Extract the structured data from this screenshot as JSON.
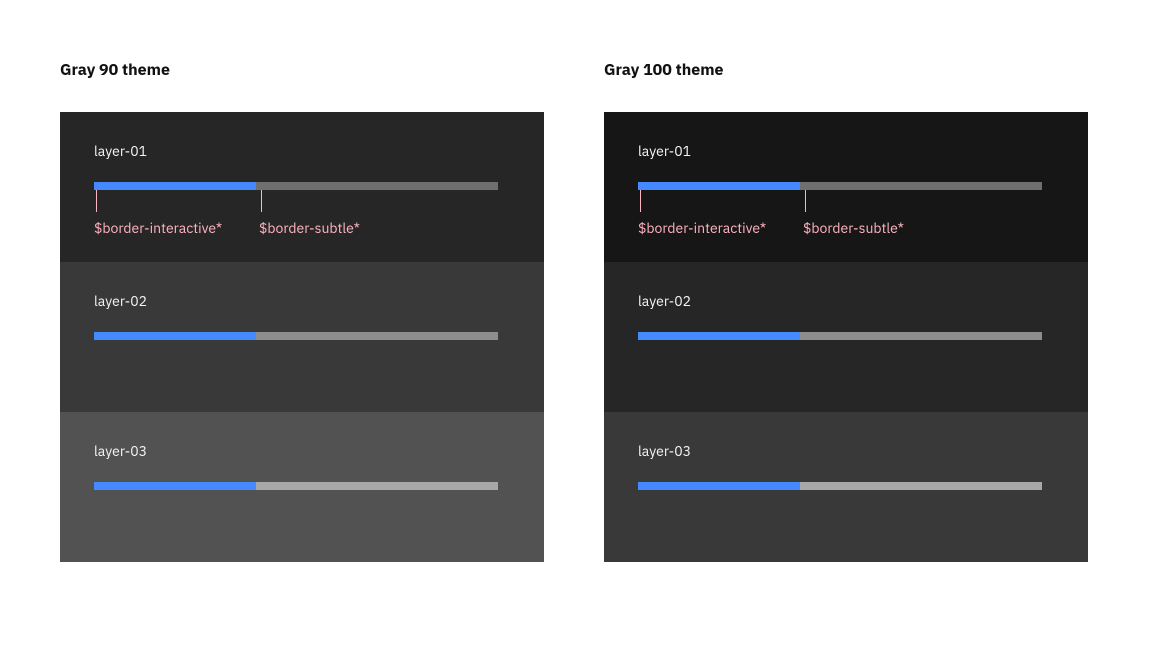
{
  "columns": [
    {
      "title": "Gray 90 theme",
      "layers": [
        {
          "label": "layer-01",
          "bg": "#262626",
          "track": "#6f6f6f",
          "fill": "#4589ff",
          "fill_percent": 40,
          "annot": true,
          "annot_left_label": "$border-interactive*",
          "annot_right_label": "$border-subtle*"
        },
        {
          "label": "layer-02",
          "bg": "#393939",
          "track": "#8d8d8d",
          "fill": "#4589ff",
          "fill_percent": 40,
          "annot": false
        },
        {
          "label": "layer-03",
          "bg": "#525252",
          "track": "#a8a8a8",
          "fill": "#4589ff",
          "fill_percent": 40,
          "annot": false
        }
      ]
    },
    {
      "title": "Gray 100 theme",
      "layers": [
        {
          "label": "layer-01",
          "bg": "#161616",
          "track": "#6f6f6f",
          "fill": "#4589ff",
          "fill_percent": 40,
          "annot": true,
          "annot_left_label": "$border-interactive*",
          "annot_right_label": "$border-subtle*"
        },
        {
          "label": "layer-02",
          "bg": "#262626",
          "track": "#8d8d8d",
          "fill": "#4589ff",
          "fill_percent": 40,
          "annot": false
        },
        {
          "label": "layer-03",
          "bg": "#393939",
          "track": "#a8a8a8",
          "fill": "#4589ff",
          "fill_percent": 40,
          "annot": false
        }
      ]
    }
  ]
}
